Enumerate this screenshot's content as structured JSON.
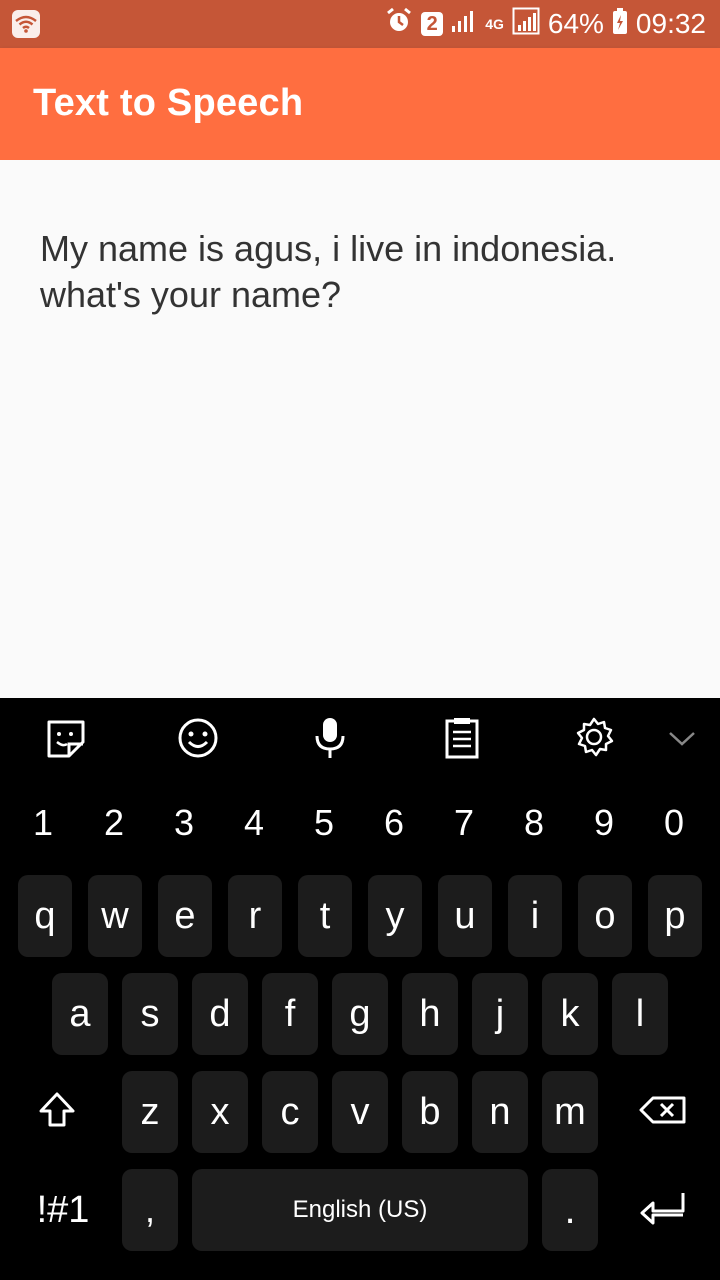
{
  "status_bar": {
    "sim_slot": "2",
    "network": "4G",
    "battery": "64%",
    "time": "09:32"
  },
  "app_bar": {
    "title": "Text to Speech"
  },
  "content": {
    "text": "My name is agus, i live in indonesia. what's your name?"
  },
  "fab": {
    "icon": "play-icon"
  },
  "keyboard": {
    "toolbar": [
      "sticker-icon",
      "emoji-icon",
      "microphone-icon",
      "clipboard-icon",
      "settings-icon",
      "chevron-down-icon"
    ],
    "number_row": [
      "1",
      "2",
      "3",
      "4",
      "5",
      "6",
      "7",
      "8",
      "9",
      "0"
    ],
    "row1": [
      "q",
      "w",
      "e",
      "r",
      "t",
      "y",
      "u",
      "i",
      "o",
      "p"
    ],
    "row2": [
      "a",
      "s",
      "d",
      "f",
      "g",
      "h",
      "j",
      "k",
      "l"
    ],
    "row3": [
      "z",
      "x",
      "c",
      "v",
      "b",
      "n",
      "m"
    ],
    "symbols_label": "!#1",
    "comma_label": ",",
    "space_label": "English (US)",
    "period_label": "."
  }
}
